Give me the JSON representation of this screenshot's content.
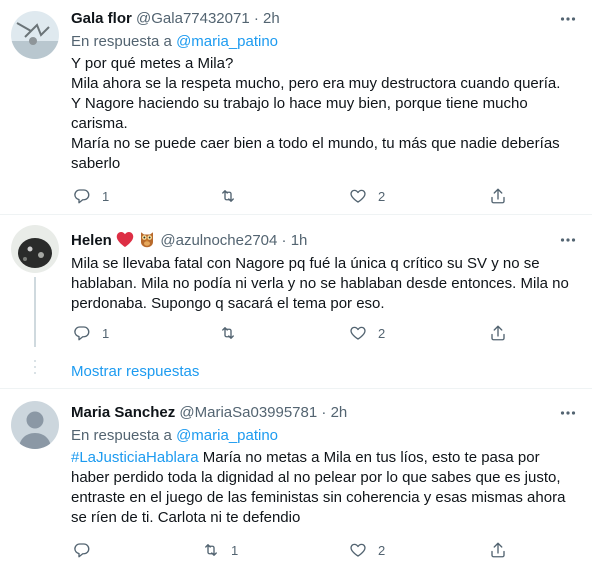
{
  "tweets": [
    {
      "name": "Gala flor",
      "handle": "@Gala77432071",
      "time": "2h",
      "reply_prefix": "En respuesta a",
      "reply_to": "@maria_patino",
      "lines": [
        "Y por qué metes a Mila?",
        "Mila ahora se la respeta mucho, pero era muy destructora cuando quería.",
        "Y Nagore haciendo su trabajo lo hace muy bien, porque tiene mucho",
        "carisma.",
        "María no se puede caer bien a todo el mundo, tu más que nadie deberías",
        "saberlo"
      ],
      "actions": {
        "reply": "1",
        "retweet": "",
        "like": "2"
      }
    },
    {
      "name": "Helen",
      "handle": "@azulnoche2704",
      "time": "1h",
      "emojis": [
        "heart-emoji",
        "owl-emoji"
      ],
      "lines": [
        "Mila se llevaba fatal con Nagore pq fué la única q crítico su SV y no se",
        "hablaban. Mila no podía ni verla y no se hablaban desde entonces. Mila no",
        "perdonaba. Supongo q sacará el tema por eso."
      ],
      "actions": {
        "reply": "1",
        "retweet": "",
        "like": "2"
      }
    },
    {
      "name": "Maria Sanchez",
      "handle": "@MariaSa03995781",
      "time": "2h",
      "reply_prefix": "En respuesta a",
      "reply_to": "@maria_patino",
      "hashtag": "#LaJusticiaHablara",
      "first_line_rest": " María no metas a Mila en tus líos, esto te pasa por",
      "lines": [
        "haber perdido toda la dignidad al no pelear por lo que sabes que es justo,",
        "entraste en el juego de las feministas sin coherencia y esas mismas ahora",
        "se ríen de ti. Carlota ni te defendio"
      ],
      "actions": {
        "reply": "",
        "retweet": "1",
        "like": "2"
      }
    }
  ],
  "show_replies": "Mostrar respuestas",
  "separator_dot": "·",
  "colors": {
    "accent": "#1d9bf0",
    "muted": "#536471",
    "text": "#0f1419",
    "divider": "#eff3f4"
  }
}
